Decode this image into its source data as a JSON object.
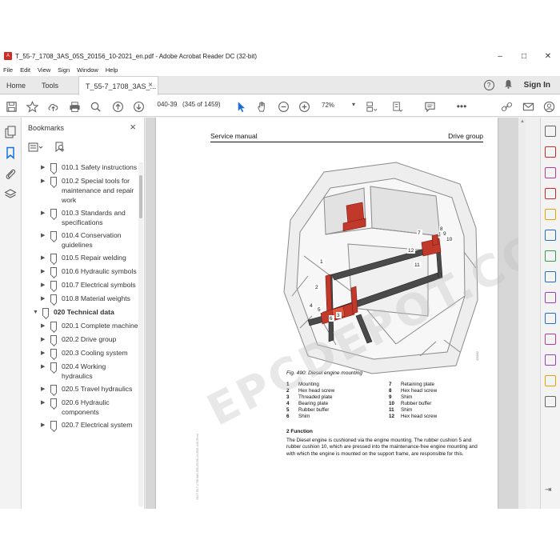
{
  "window": {
    "title": "T_55-7_1708_3AS_05S_20156_10-2021_en.pdf - Adobe Acrobat Reader DC (32-bit)",
    "minimize": "–",
    "maximize": "□",
    "close": "✕"
  },
  "menu": [
    "File",
    "Edit",
    "View",
    "Sign",
    "Window",
    "Help"
  ],
  "tabs": {
    "home": "Home",
    "tools": "Tools",
    "doc": "T_55-7_1708_3AS_...",
    "doc_close": "×"
  },
  "header_right": {
    "help": "?",
    "sign_in": "Sign In"
  },
  "toolbar": {
    "page_input": "040-39",
    "page_count": "(345 of 1459)",
    "zoom": "72%"
  },
  "bookmarks": {
    "title": "Bookmarks",
    "close": "×",
    "items": [
      {
        "label": "010.1 Safety instructions",
        "level": 2
      },
      {
        "label": "010.2 Special tools for maintenance and repair work",
        "level": 2
      },
      {
        "label": "010.3 Standards and specifications",
        "level": 2
      },
      {
        "label": "010.4 Conservation guidelines",
        "level": 2
      },
      {
        "label": "010.5 Repair welding",
        "level": 2
      },
      {
        "label": "010.6 Hydraulic symbols",
        "level": 2
      },
      {
        "label": "010.7 Electrical symbols",
        "level": 2
      },
      {
        "label": "010.8 Material weights",
        "level": 2
      },
      {
        "label": "020 Technical data",
        "level": 1,
        "expanded": true
      },
      {
        "label": "020.1 Complete machine",
        "level": 2
      },
      {
        "label": "020.2 Drive group",
        "level": 2
      },
      {
        "label": "020.3 Cooling system",
        "level": 2
      },
      {
        "label": "020.4 Working hydraulics",
        "level": 2
      },
      {
        "label": "020.5 Travel hydraulics",
        "level": 2
      },
      {
        "label": "020.6 Hydraulic components",
        "level": 2
      },
      {
        "label": "020.7 Electrical system",
        "level": 2
      }
    ]
  },
  "page": {
    "header_left": "Service manual",
    "header_right": "Drive group",
    "figure_caption": "Fig. 490: Diesel engine mounting",
    "figure_code": "432882",
    "legend_left": [
      {
        "num": "1",
        "text": "Mounting"
      },
      {
        "num": "2",
        "text": "Hex head screw"
      },
      {
        "num": "3",
        "text": "Threaded plate"
      },
      {
        "num": "4",
        "text": "Bearing plate"
      },
      {
        "num": "5",
        "text": "Rubber buffer"
      },
      {
        "num": "6",
        "text": "Shim"
      }
    ],
    "legend_right": [
      {
        "num": "7",
        "text": "Retaining plate"
      },
      {
        "num": "8",
        "text": "Hex head screw"
      },
      {
        "num": "9",
        "text": "Shim"
      },
      {
        "num": "10",
        "text": "Rubber buffer"
      },
      {
        "num": "11",
        "text": "Shim"
      },
      {
        "num": "12",
        "text": "Hex head screw"
      }
    ],
    "function_title": "2 Function",
    "function_text": "The Diesel engine is cushioned via the engine mounting. The rubber cushion 5 and rubber cushion 10, which are pressed into the maintenance-free engine mounting and with which the engine is mounted on the support frame, are responsible for this.",
    "side_code": "SM-T-55-7-1708-3AS-05S-20156-10-2021-040-39-en",
    "callouts": [
      "1",
      "2",
      "3",
      "4",
      "5",
      "6",
      "7",
      "8",
      "9",
      "10",
      "11",
      "12"
    ]
  },
  "watermark": "EPCDEPOT.COM",
  "colors": {
    "accent": "#d12a25",
    "selection": "#1473e6",
    "frame_red": "#c0392b"
  }
}
